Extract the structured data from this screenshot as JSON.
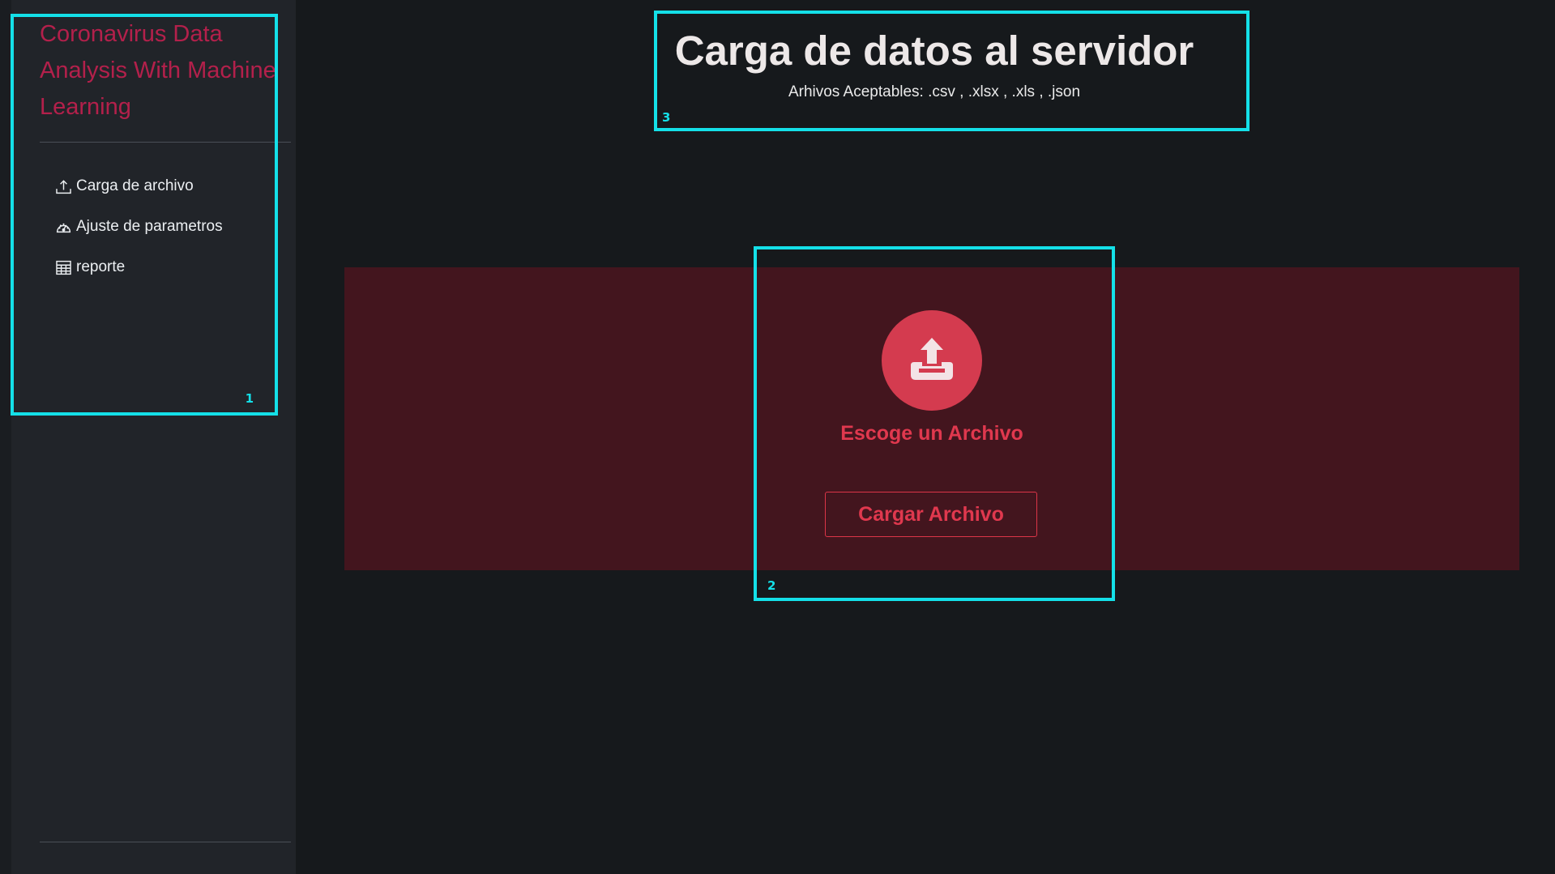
{
  "colors": {
    "background": "#16191c",
    "sidebar": "#212429",
    "brand": "#b3204b",
    "accent": "#dc3548",
    "upload_band": "#43151e",
    "annotation": "#14e0e8"
  },
  "sidebar": {
    "brand": "Coronavirus Data Analysis With Machine Learning",
    "items": [
      {
        "label": "Carga de archivo",
        "icon": "upload-icon"
      },
      {
        "label": "Ajuste de parametros",
        "icon": "speedometer-icon"
      },
      {
        "label": "reporte",
        "icon": "table-icon"
      }
    ]
  },
  "header": {
    "title": "Carga de datos al servidor",
    "subtitle": "Arhivos Aceptables: .csv , .xlsx , .xls , .json"
  },
  "upload": {
    "icon": "inbox-upload-icon",
    "choose_label": "Escoge un Archivo",
    "button_label": "Cargar Archivo"
  },
  "annotations": [
    {
      "label": "1"
    },
    {
      "label": "2"
    },
    {
      "label": "3"
    }
  ]
}
